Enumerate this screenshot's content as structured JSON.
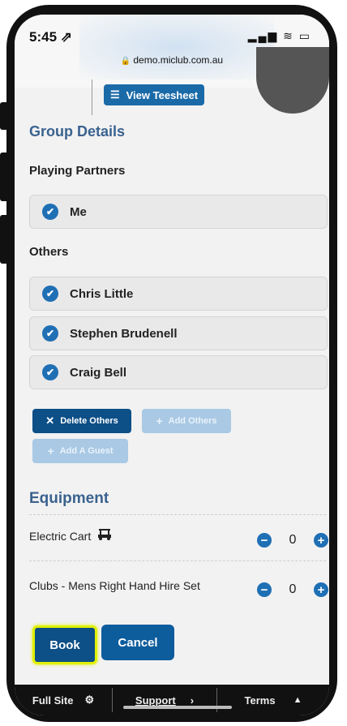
{
  "status_bar": {
    "time": "5:45 ⇗",
    "indicators": "▂▄▆ ≋ ▭"
  },
  "browser": {
    "url": "demo.miclub.com.au"
  },
  "header": {
    "teesheet_label": "View Teesheet",
    "teesheet_icon": "list-icon"
  },
  "group_details": {
    "title": "Group Details",
    "playing_partners_label": "Playing Partners",
    "partners": [
      {
        "name": "Me"
      }
    ],
    "others_label": "Others",
    "others": [
      {
        "name": "Chris Little"
      },
      {
        "name": "Stephen Brudenell"
      },
      {
        "name": "Craig Bell"
      }
    ],
    "delete_others_label": "Delete Others",
    "add_others_label": "Add Others",
    "add_guest_label": "Add A Guest"
  },
  "equipment": {
    "title": "Equipment",
    "items": [
      {
        "name": "Electric Cart",
        "icon": "golf-cart-icon",
        "quantity": "0"
      },
      {
        "name": "Clubs - Mens Right Hand Hire Set",
        "quantity": "0"
      }
    ]
  },
  "actions": {
    "book_label": "Book",
    "cancel_label": "Cancel"
  },
  "footer": {
    "full_site": "Full Site",
    "support": "Support",
    "terms": "Terms"
  },
  "colors": {
    "primary": "#0d4f87",
    "accent": "#1f6fb5",
    "disabled": "#a9c9e4",
    "section_title": "#3a628f",
    "focus_outline": "#e0f000"
  }
}
